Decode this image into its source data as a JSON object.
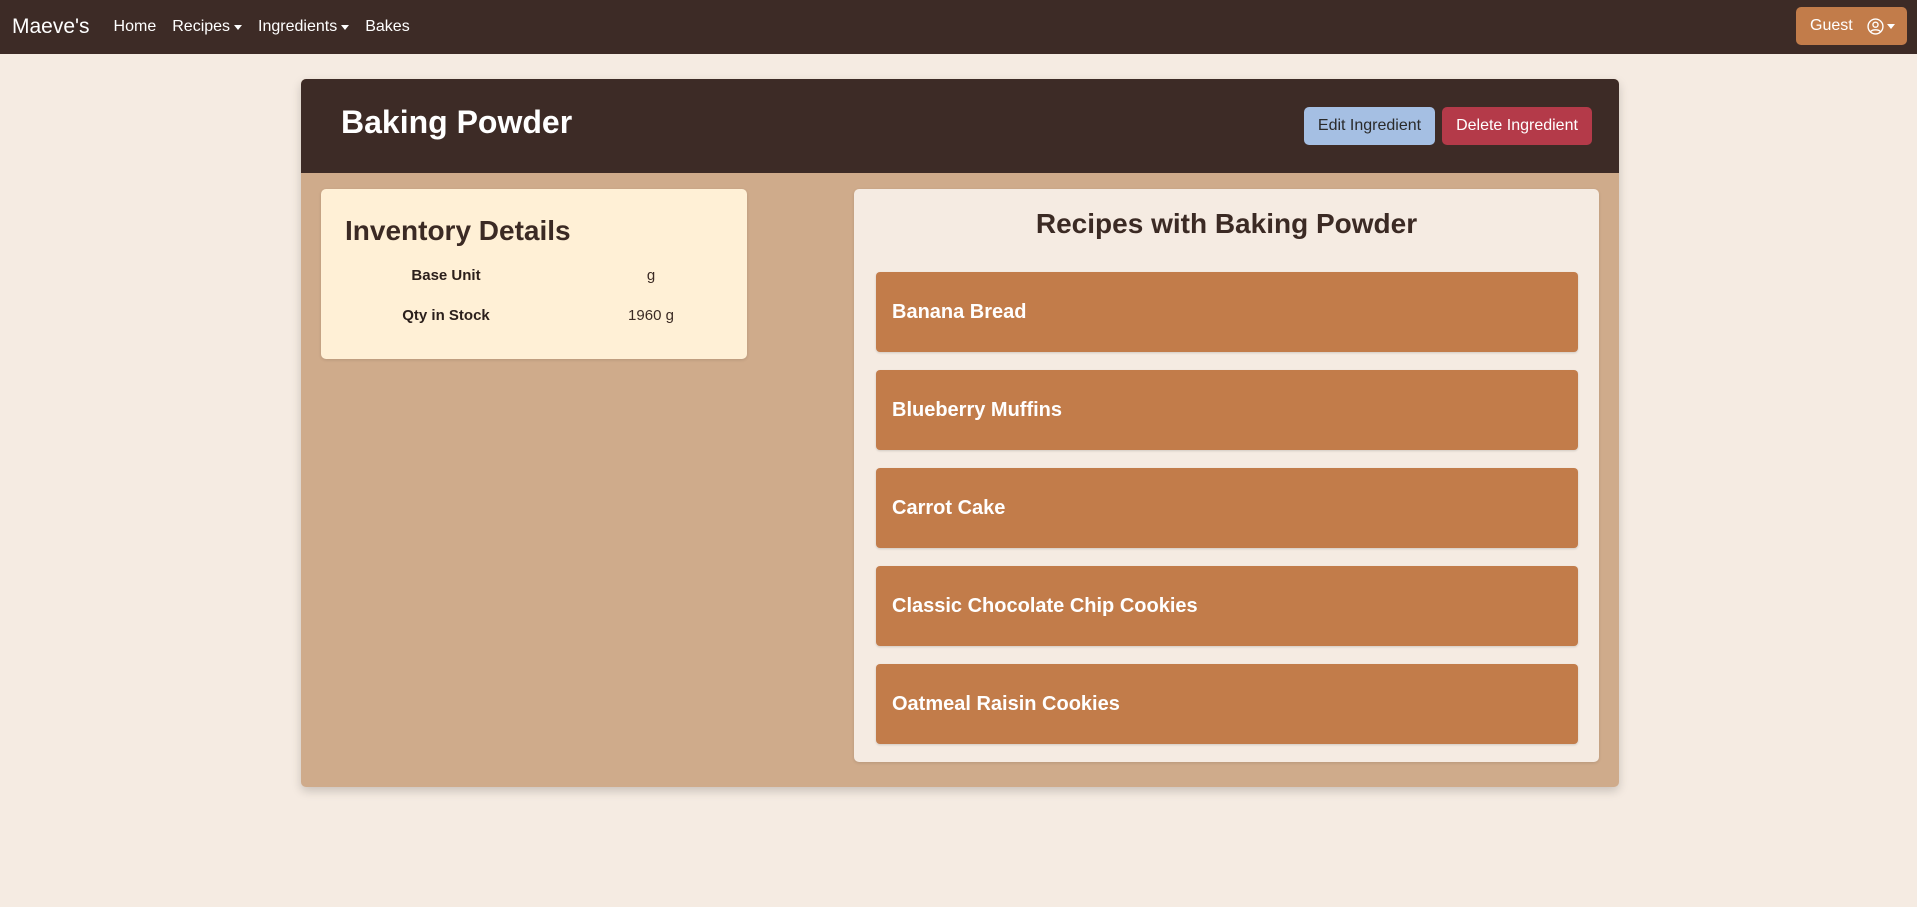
{
  "navbar": {
    "brand": "Maeve's",
    "links": [
      {
        "label": "Home",
        "dropdown": false
      },
      {
        "label": "Recipes",
        "dropdown": true
      },
      {
        "label": "Ingredients",
        "dropdown": true
      },
      {
        "label": "Bakes",
        "dropdown": false
      }
    ],
    "user": {
      "label": "Guest",
      "icon": "user-circle-icon"
    }
  },
  "ingredient": {
    "name": "Baking Powder",
    "actions": {
      "edit_label": "Edit Ingredient",
      "delete_label": "Delete Ingredient"
    }
  },
  "inventory": {
    "title": "Inventory Details",
    "rows": [
      {
        "label": "Base Unit",
        "value": "g"
      },
      {
        "label": "Qty in Stock",
        "value": "1960 g"
      }
    ]
  },
  "recipes": {
    "title": "Recipes with Baking Powder",
    "items": [
      {
        "label": "Banana Bread"
      },
      {
        "label": "Blueberry Muffins"
      },
      {
        "label": "Carrot Cake"
      },
      {
        "label": "Classic Chocolate Chip Cookies"
      },
      {
        "label": "Oatmeal Raisin Cookies"
      }
    ]
  },
  "colors": {
    "navbar_bg": "#3d2b26",
    "page_bg": "#f5ebe2",
    "accent": "#c27c4a",
    "panel_bg": "#cfab8b",
    "edit_button": "#a5bfe3",
    "delete_button": "#b43a49",
    "inventory_bg": "#fff0d6"
  }
}
